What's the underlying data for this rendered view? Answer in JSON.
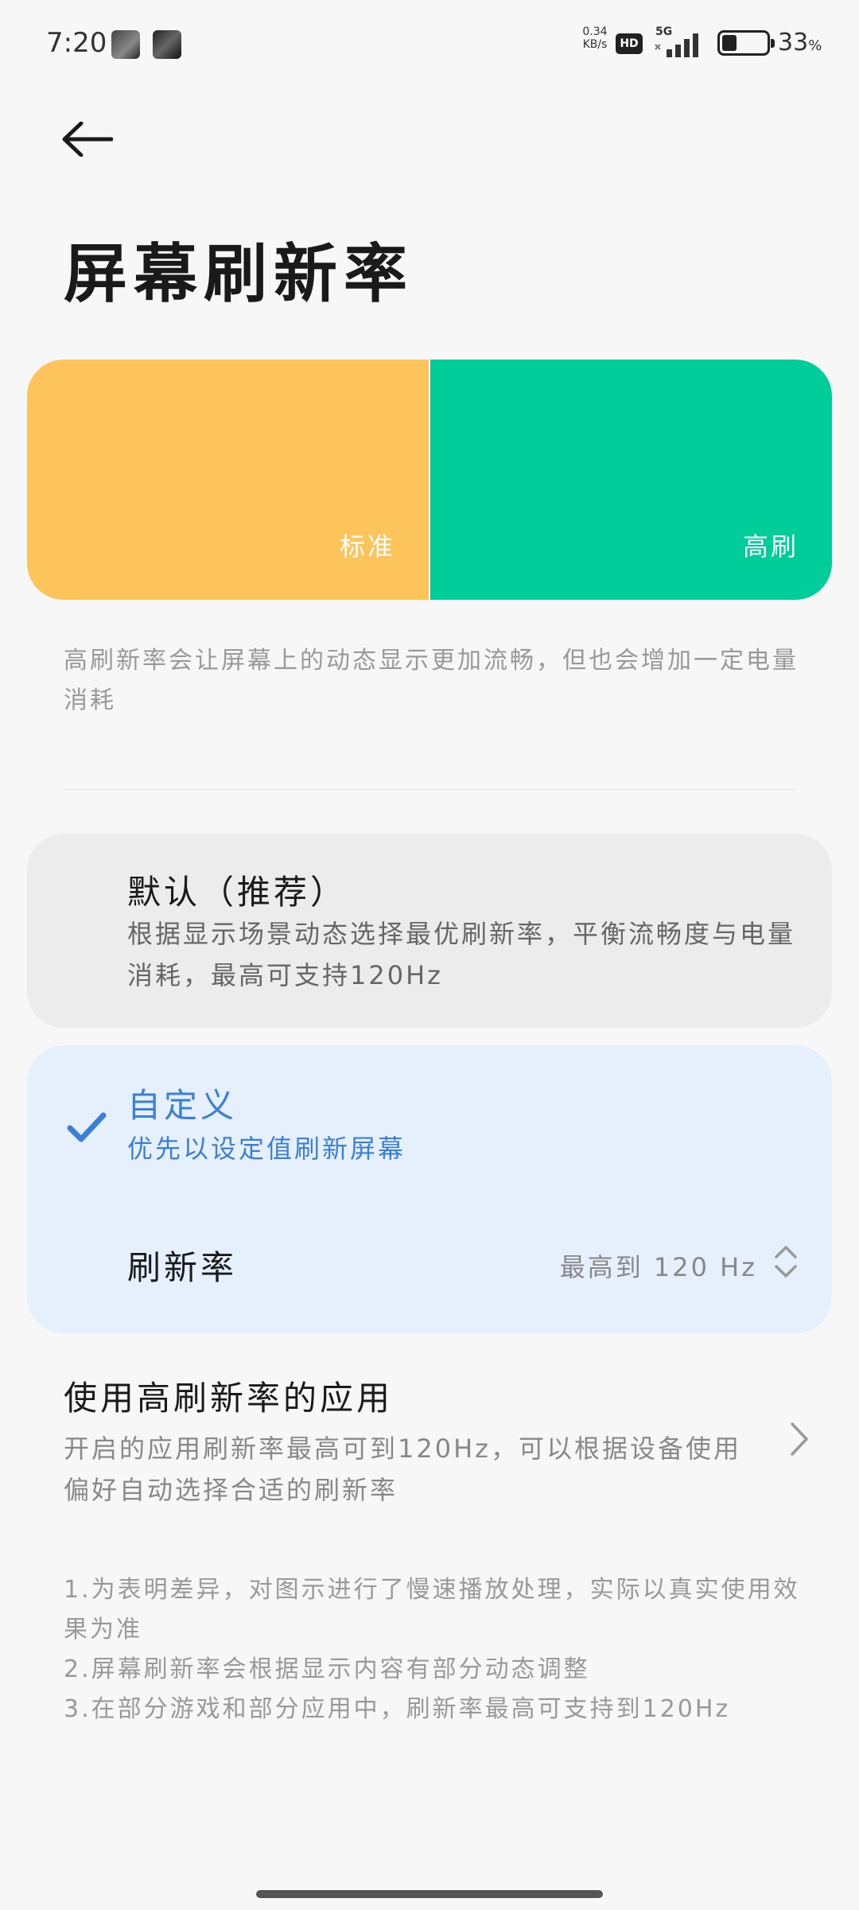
{
  "status_bar": {
    "time": "7:20",
    "net_speed_value": "0.34",
    "net_speed_unit": "KB/s",
    "hd_badge": "HD",
    "network": "5G",
    "battery_percent": "33",
    "battery_level": 0.33
  },
  "header": {
    "title": "屏幕刷新率"
  },
  "preview": {
    "standard_label": "标准",
    "high_label": "高刷",
    "standard_color": "#fcc45a",
    "high_color": "#00cd99"
  },
  "description": "高刷新率会让屏幕上的动态显示更加流畅，但也会增加一定电量消耗",
  "options": {
    "default": {
      "title": "默认（推荐）",
      "desc": "根据显示场景动态选择最优刷新率，平衡流畅度与电量消耗，最高可支持120Hz"
    },
    "custom": {
      "title": "自定义",
      "desc": "优先以设定值刷新屏幕",
      "selected": true,
      "rate_label": "刷新率",
      "rate_value": "最高到 120 Hz"
    }
  },
  "apps": {
    "title": "使用高刷新率的应用",
    "desc": "开启的应用刷新率最高可到120Hz，可以根据设备使用偏好自动选择合适的刷新率"
  },
  "notes": [
    "1.为表明差异，对图示进行了慢速播放处理，实际以真实使用效果为准",
    "2.屏幕刷新率会根据显示内容有部分动态调整",
    "3.在部分游戏和部分应用中，刷新率最高可支持到120Hz"
  ],
  "colors": {
    "accent": "#3b7fd6",
    "selected_card_bg": "#e6f0fd"
  }
}
